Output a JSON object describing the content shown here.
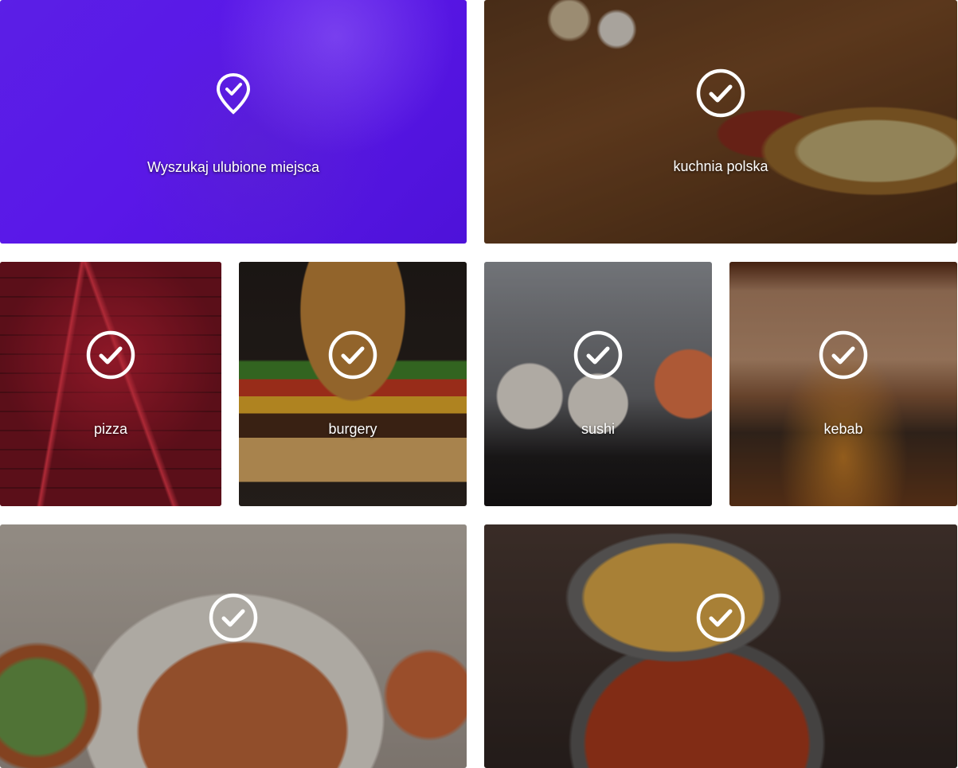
{
  "tiles": [
    {
      "id": "search",
      "label": "Wyszukaj ulubione miejsca",
      "icon": "map-pin-check-icon",
      "accent": "#5a17e8"
    },
    {
      "id": "polish",
      "label": "kuchnia polska",
      "icon": "check-circle-icon"
    },
    {
      "id": "pizza",
      "label": "pizza",
      "icon": "check-circle-icon"
    },
    {
      "id": "burgery",
      "label": "burgery",
      "icon": "check-circle-icon"
    },
    {
      "id": "sushi",
      "label": "sushi",
      "icon": "check-circle-icon"
    },
    {
      "id": "kebab",
      "label": "kebab",
      "icon": "check-circle-icon"
    },
    {
      "id": "bowl",
      "label": "",
      "icon": "check-circle-icon"
    },
    {
      "id": "curry",
      "label": "",
      "icon": "check-circle-icon"
    }
  ]
}
